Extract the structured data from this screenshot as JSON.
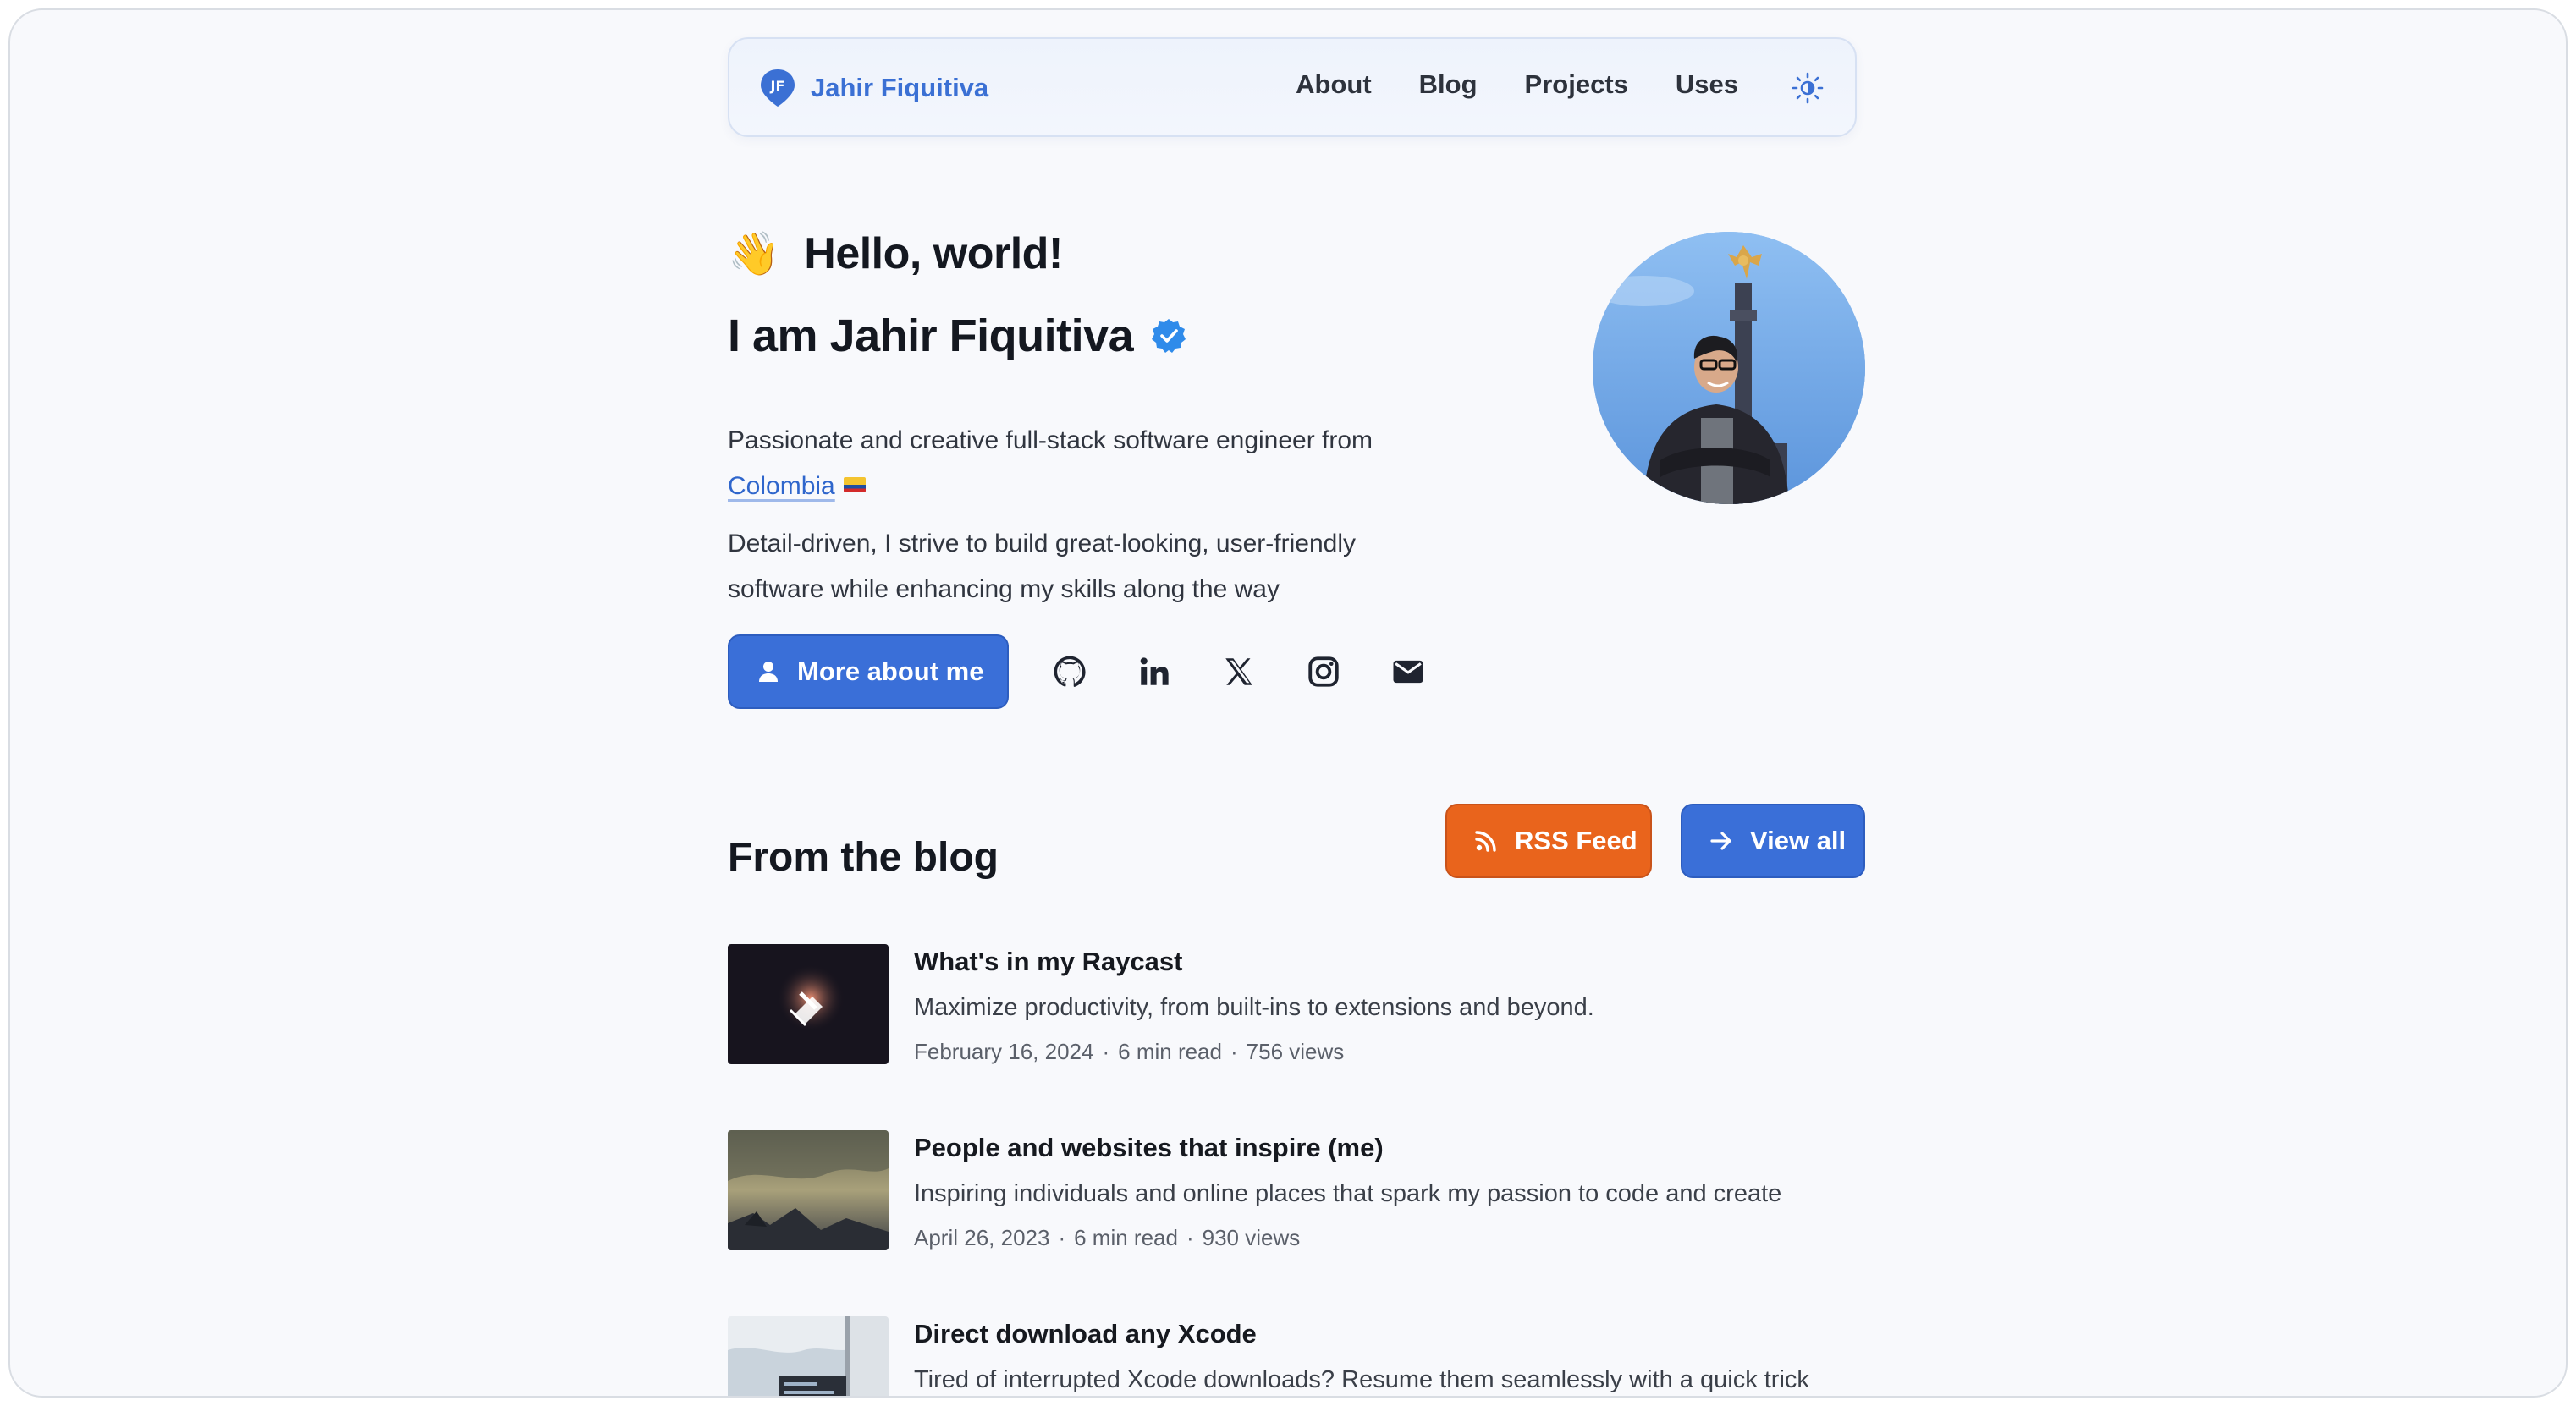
{
  "header": {
    "brand_name": "Jahir Fiquitiva",
    "nav": [
      "About",
      "Blog",
      "Projects",
      "Uses"
    ]
  },
  "hero": {
    "wave_emoji": "👋",
    "greeting": "Hello, world!",
    "intro": "I am Jahir Fiquitiva",
    "para1_prefix": "Passionate and creative full-stack software engineer from ",
    "country": "Colombia",
    "para2": "Detail-driven, I strive to build great-looking, user-friendly software while enhancing my skills along the way",
    "more_button": "More about me",
    "social_icons": [
      "github-icon",
      "linkedin-icon",
      "x-icon",
      "instagram-icon",
      "email-icon"
    ]
  },
  "blog": {
    "title": "From the blog",
    "rss_button": "RSS Feed",
    "view_all_button": "View all",
    "posts": [
      {
        "title": "What's in my Raycast",
        "description": "Maximize productivity, from built-ins to extensions and beyond.",
        "date": "February 16, 2024",
        "read_time": "6 min read",
        "views": "756 views"
      },
      {
        "title": "People and websites that inspire (me)",
        "description": "Inspiring individuals and online places that spark my passion to code and create",
        "date": "April 26, 2023",
        "read_time": "6 min read",
        "views": "930 views"
      },
      {
        "title": "Direct download any Xcode",
        "description": "Tired of interrupted Xcode downloads? Resume them seamlessly with a quick trick"
      }
    ]
  },
  "colors": {
    "accent": "#3a6fd8",
    "rss": "#e9641c",
    "background": "#f8f9fc"
  }
}
